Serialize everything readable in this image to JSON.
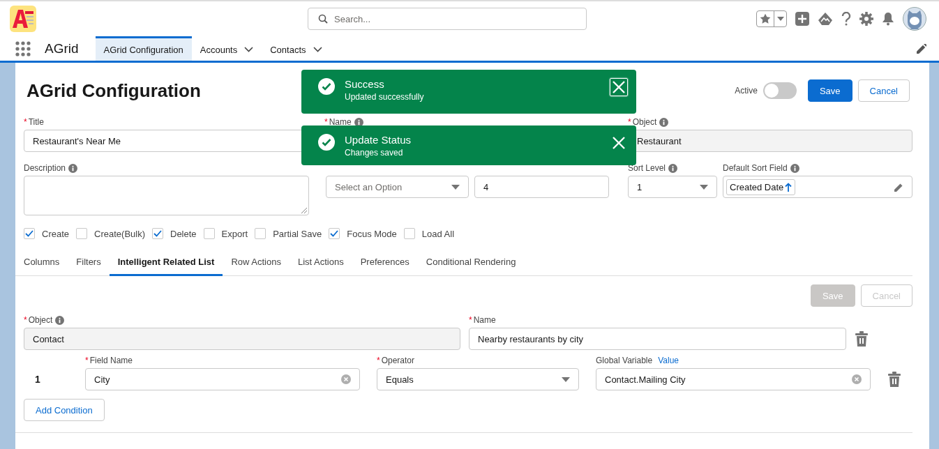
{
  "header": {
    "search": {
      "placeholder": "Search..."
    }
  },
  "nav": {
    "app_name": "AGrid",
    "tabs": [
      {
        "label": "AGrid Configuration",
        "selected": true,
        "has_menu": false
      },
      {
        "label": "Accounts",
        "selected": false,
        "has_menu": true
      },
      {
        "label": "Contacts",
        "selected": false,
        "has_menu": true
      }
    ]
  },
  "required_mark": "*",
  "page": {
    "title": "AGrid Configuration",
    "active": {
      "label": "Active",
      "on": false
    },
    "buttons": [
      {
        "label": "Save",
        "kind": "brand"
      },
      {
        "label": "Cancel",
        "kind": "neutral"
      }
    ]
  },
  "toasts": [
    {
      "title": "Success",
      "message": "Updated successfully",
      "close_focused": true
    },
    {
      "title": "Update Status",
      "message": "Changes saved",
      "close_focused": false
    }
  ],
  "form_rows": [
    [
      {
        "label": "Title",
        "required": true,
        "info": false,
        "kind": "input",
        "value": "Restaurant's Near Me"
      },
      {
        "label": "Name",
        "required": true,
        "info": true,
        "kind": "covered"
      },
      {
        "label": "Object",
        "required": true,
        "info": true,
        "kind": "readonly",
        "value": "Restaurant"
      }
    ],
    [
      {
        "label": "Description",
        "required": false,
        "info": true,
        "kind": "textarea"
      },
      {
        "kind": "select",
        "placeholder": "Select an Option"
      },
      {
        "kind": "input",
        "value": "4"
      },
      {
        "label": "Sort Level",
        "required": false,
        "info": true,
        "kind": "select",
        "value": "1"
      },
      {
        "label": "Default Sort Field",
        "required": false,
        "info": true,
        "kind": "pill",
        "value": "Created Date"
      }
    ]
  ],
  "checkboxes": [
    {
      "label": "Create",
      "checked": true
    },
    {
      "label": "Create(Bulk)",
      "checked": false
    },
    {
      "label": "Delete",
      "checked": true
    },
    {
      "label": "Export",
      "checked": false
    },
    {
      "label": "Partial Save",
      "checked": false
    },
    {
      "label": "Focus Mode",
      "checked": true
    },
    {
      "label": "Load All",
      "checked": false
    }
  ],
  "tabs": [
    {
      "label": "Columns",
      "selected": false
    },
    {
      "label": "Filters",
      "selected": false
    },
    {
      "label": "Intelligent Related List",
      "selected": true
    },
    {
      "label": "Row Actions",
      "selected": false
    },
    {
      "label": "List Actions",
      "selected": false
    },
    {
      "label": "Preferences",
      "selected": false
    },
    {
      "label": "Conditional Rendering",
      "selected": false
    }
  ],
  "related": {
    "buttons": [
      {
        "label": "Save",
        "disabled": true
      },
      {
        "label": "Cancel",
        "disabled": true
      }
    ],
    "object": {
      "label": "Object",
      "required": true,
      "info": true,
      "value": "Contact"
    },
    "name": {
      "label": "Name",
      "required": true,
      "value": "Nearby restaurants by city"
    },
    "conditions": [
      {
        "number": "1",
        "field_name": {
          "label": "Field Name",
          "required": true,
          "value": "City"
        },
        "operator": {
          "label": "Operator",
          "required": true,
          "value": "Equals"
        },
        "global_variable": {
          "label": "Global Variable",
          "link": "Value",
          "value": "Contact.Mailing City"
        }
      }
    ],
    "add_condition": "Add Condition"
  }
}
